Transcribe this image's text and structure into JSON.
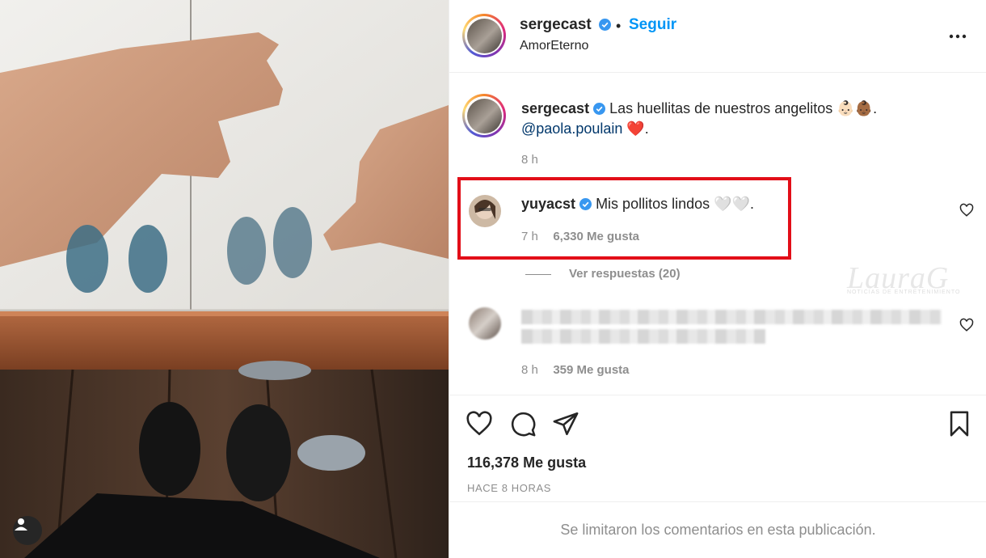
{
  "post": {
    "author": "sergecast",
    "follow_label": "Seguir",
    "separator": "•",
    "location": "AmorEterno"
  },
  "caption": {
    "author": "sergecast",
    "text": "Las huellitas de nuestros angelitos 👶🏻👶🏾.",
    "mention": "@paola.poulain",
    "mention_suffix": " ❤️.",
    "time": "8 h"
  },
  "comments": [
    {
      "author": "yuyacst",
      "text": "Mis pollitos lindos 🤍🤍.",
      "time": "7 h",
      "likes": "6,330 Me gusta",
      "replies_label": "Ver respuestas (20)"
    },
    {
      "author": "",
      "text": "",
      "time": "8 h",
      "likes": "359 Me gusta"
    }
  ],
  "actions": {
    "likes": "116,378 Me gusta",
    "posted_ago": "HACE 8 HORAS"
  },
  "footer": {
    "comments_limited": "Se limitaron los comentarios en esta publicación."
  },
  "watermark": {
    "brand": "LauraG",
    "sub": "NOTICIAS DE ENTRETENIMIENTO"
  },
  "colors": {
    "follow": "#0095f6",
    "verified": "#3897f0",
    "highlight": "#e20e18",
    "mention": "#00376b"
  },
  "icons": [
    "more-options-icon",
    "verified-badge-icon",
    "heart-icon",
    "comment-icon",
    "share-icon",
    "bookmark-icon",
    "user-tag-icon"
  ]
}
